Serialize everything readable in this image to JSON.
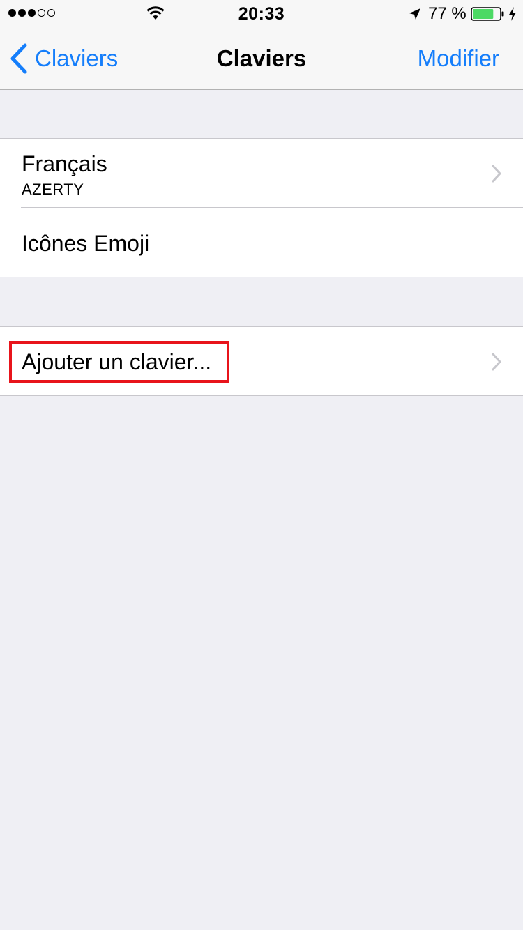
{
  "status_bar": {
    "signal_dots_filled": 3,
    "signal_dots_total": 5,
    "time": "20:33",
    "battery_percent_label": "77 %",
    "battery_level": 0.77,
    "icons": [
      "wifi-icon",
      "location-arrow-icon",
      "battery-icon",
      "charging-bolt-icon"
    ]
  },
  "nav": {
    "back_label": "Claviers",
    "title": "Claviers",
    "edit_label": "Modifier",
    "accent_color": "#157efb"
  },
  "keyboards": [
    {
      "title": "Français",
      "subtitle": "AZERTY"
    },
    {
      "title": "Icônes Emoji"
    }
  ],
  "add_keyboard": {
    "label": "Ajouter un clavier..."
  },
  "colors": {
    "background": "#efeff4",
    "highlight": "#e8141b",
    "battery_fill": "#4cd964"
  }
}
